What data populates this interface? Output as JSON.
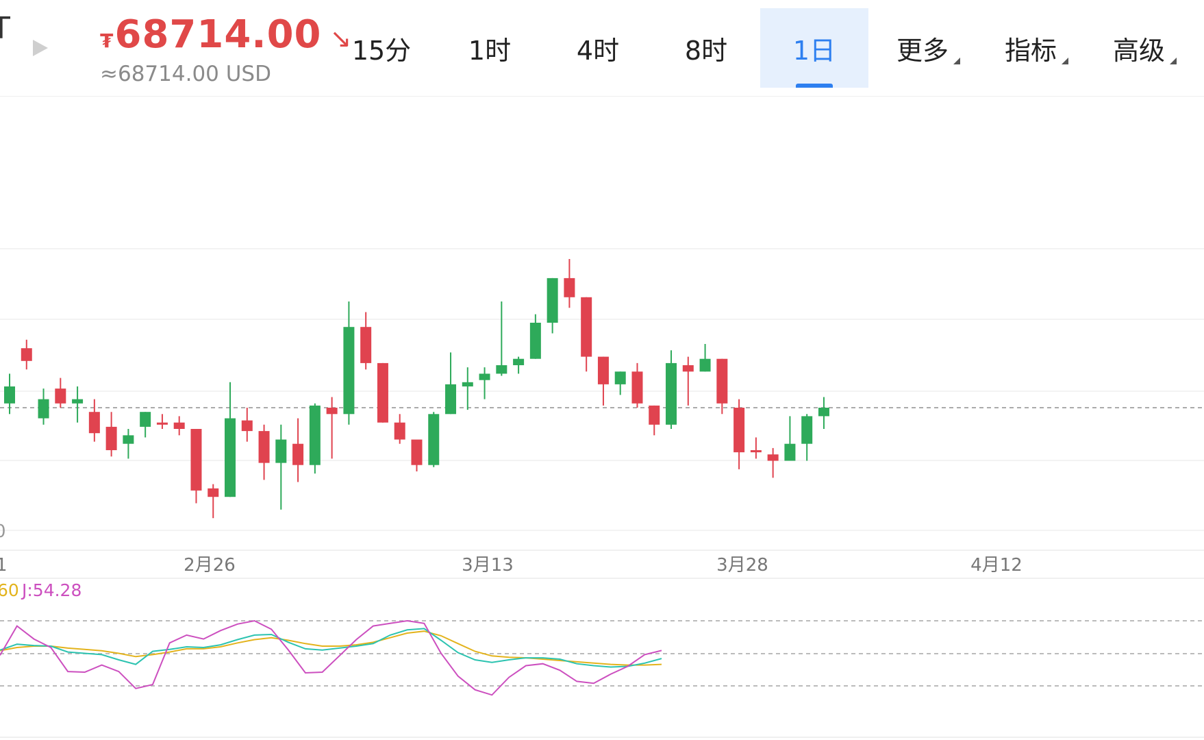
{
  "header": {
    "cut_text": "T",
    "currency_symbol": "₮",
    "price": "68714.00",
    "usd": "≈68714.00 USD",
    "down_color": "#e04848"
  },
  "tabs": [
    {
      "label": "15分",
      "active": false,
      "dropdown": false
    },
    {
      "label": "1时",
      "active": false,
      "dropdown": false
    },
    {
      "label": "4时",
      "active": false,
      "dropdown": false
    },
    {
      "label": "8时",
      "active": false,
      "dropdown": false
    },
    {
      "label": "1日",
      "active": true,
      "dropdown": false
    },
    {
      "label": "更多",
      "active": false,
      "dropdown": true
    },
    {
      "label": "指标",
      "active": false,
      "dropdown": true
    },
    {
      "label": "高级",
      "active": false,
      "dropdown": true
    }
  ],
  "colors": {
    "up": "#2eaa5a",
    "down": "#e0434f",
    "accent": "#2d7ff0",
    "k_line": "#2cc3b0",
    "d_line": "#e3b31c",
    "j_line": "#cc4fbf"
  },
  "chart_data": {
    "type": "candlestick",
    "x_tick_labels": [
      "1",
      "2月26",
      "3月13",
      "3月28",
      "4月12"
    ],
    "y_tick_labels": [
      "0"
    ],
    "kdj_label_partial": "60",
    "kdj_j_label": "J:54.28",
    "candles": [
      {
        "dir": "up",
        "o": 2,
        "c": 10,
        "h": 16,
        "l": -3
      },
      {
        "dir": "down",
        "o": 28,
        "c": 22,
        "h": 32,
        "l": 18
      },
      {
        "dir": "up",
        "o": -5,
        "c": 4,
        "h": 9,
        "l": -8
      },
      {
        "dir": "down",
        "o": 9,
        "c": 2,
        "h": 14,
        "l": 0
      },
      {
        "dir": "up",
        "o": 2,
        "c": 4,
        "h": 10,
        "l": -7
      },
      {
        "dir": "down",
        "o": -2,
        "c": -12,
        "h": 4,
        "l": -16
      },
      {
        "dir": "down",
        "o": -9,
        "c": -20,
        "h": -2,
        "l": -23
      },
      {
        "dir": "up",
        "o": -17,
        "c": -13,
        "h": -10,
        "l": -24
      },
      {
        "dir": "up",
        "o": -9,
        "c": -2,
        "h": -2,
        "l": -14
      },
      {
        "dir": "down",
        "o": -7,
        "c": -8,
        "h": -3,
        "l": -10
      },
      {
        "dir": "down",
        "o": -7,
        "c": -10,
        "h": -4,
        "l": -13
      },
      {
        "dir": "down",
        "o": -10,
        "c": -39,
        "h": -10,
        "l": -45
      },
      {
        "dir": "down",
        "o": -38,
        "c": -42,
        "h": -36,
        "l": -52
      },
      {
        "dir": "up",
        "o": -42,
        "c": -5,
        "h": 12,
        "l": -42
      },
      {
        "dir": "down",
        "o": -6,
        "c": -11,
        "h": 0,
        "l": -16
      },
      {
        "dir": "down",
        "o": -11,
        "c": -26,
        "h": -8,
        "l": -34
      },
      {
        "dir": "up",
        "o": -26,
        "c": -15,
        "h": -8,
        "l": -48
      },
      {
        "dir": "down",
        "o": -17,
        "c": -27,
        "h": -5,
        "l": -35
      },
      {
        "dir": "up",
        "o": -27,
        "c": 1,
        "h": 2,
        "l": -31
      },
      {
        "dir": "down",
        "o": 0,
        "c": -3,
        "h": 5,
        "l": -24
      },
      {
        "dir": "up",
        "o": -3,
        "c": 38,
        "h": 50,
        "l": -8
      },
      {
        "dir": "down",
        "o": 38,
        "c": 21,
        "h": 45,
        "l": 18
      },
      {
        "dir": "down",
        "o": 21,
        "c": -7,
        "h": 21,
        "l": -7
      },
      {
        "dir": "down",
        "o": -7,
        "c": -15,
        "h": -3,
        "l": -17
      },
      {
        "dir": "down",
        "o": -15,
        "c": -27,
        "h": -15,
        "l": -30
      },
      {
        "dir": "up",
        "o": -27,
        "c": -3,
        "h": -2,
        "l": -28
      },
      {
        "dir": "up",
        "o": -3,
        "c": 11,
        "h": 26,
        "l": -3
      },
      {
        "dir": "up",
        "o": 10,
        "c": 12,
        "h": 19,
        "l": -1
      },
      {
        "dir": "up",
        "o": 13,
        "c": 16,
        "h": 19,
        "l": 4
      },
      {
        "dir": "up",
        "o": 16,
        "c": 20,
        "h": 50,
        "l": 15
      },
      {
        "dir": "up",
        "o": 20,
        "c": 23,
        "h": 24,
        "l": 16
      },
      {
        "dir": "up",
        "o": 23,
        "c": 40,
        "h": 44,
        "l": 23
      },
      {
        "dir": "up",
        "o": 40,
        "c": 61,
        "h": 61,
        "l": 35
      },
      {
        "dir": "down",
        "o": 61,
        "c": 52,
        "h": 70,
        "l": 47
      },
      {
        "dir": "down",
        "o": 52,
        "c": 24,
        "h": 52,
        "l": 17
      },
      {
        "dir": "down",
        "o": 24,
        "c": 11,
        "h": 24,
        "l": 1
      },
      {
        "dir": "up",
        "o": 11,
        "c": 17,
        "h": 17,
        "l": 6
      },
      {
        "dir": "down",
        "o": 17,
        "c": 2,
        "h": 21,
        "l": 0
      },
      {
        "dir": "down",
        "o": 1,
        "c": -8,
        "h": 1,
        "l": -13
      },
      {
        "dir": "up",
        "o": -8,
        "c": 21,
        "h": 27,
        "l": -10
      },
      {
        "dir": "down",
        "o": 20,
        "c": 17,
        "h": 24,
        "l": 1
      },
      {
        "dir": "up",
        "o": 17,
        "c": 23,
        "h": 30,
        "l": 17
      },
      {
        "dir": "down",
        "o": 23,
        "c": 2,
        "h": 23,
        "l": -3
      },
      {
        "dir": "down",
        "o": 0,
        "c": -21,
        "h": 4,
        "l": -29
      },
      {
        "dir": "down",
        "o": -20,
        "c": -21,
        "h": -14,
        "l": -24
      },
      {
        "dir": "down",
        "o": -22,
        "c": -25,
        "h": -19,
        "l": -33
      },
      {
        "dir": "up",
        "o": -25,
        "c": -17,
        "h": -4,
        "l": -25
      },
      {
        "dir": "up",
        "o": -17,
        "c": -4,
        "h": -3,
        "l": -25
      },
      {
        "dir": "up",
        "o": -4,
        "c": 0,
        "h": 5,
        "l": -10
      }
    ],
    "k_series": [
      55,
      64,
      62,
      61,
      52,
      50,
      48,
      40,
      33,
      53,
      56,
      60,
      59,
      63,
      71,
      78,
      79,
      67,
      57,
      55,
      58,
      61,
      65,
      78,
      86,
      88,
      70,
      51,
      40,
      36,
      40,
      43,
      43,
      41,
      34,
      31,
      29,
      30,
      35,
      42
    ],
    "d_series": [
      54,
      59,
      61,
      61,
      58,
      56,
      54,
      50,
      45,
      48,
      52,
      57,
      57,
      60,
      66,
      71,
      74,
      70,
      65,
      61,
      61,
      63,
      67,
      74,
      81,
      84,
      77,
      65,
      53,
      46,
      44,
      43,
      41,
      39,
      37,
      35,
      33,
      32,
      32,
      33
    ],
    "j_series": [
      47,
      92,
      72,
      59,
      22,
      21,
      32,
      22,
      -4,
      2,
      66,
      78,
      72,
      85,
      95,
      100,
      87,
      55,
      20,
      21,
      46,
      71,
      92,
      96,
      100,
      96,
      50,
      15,
      -6,
      -14,
      13,
      31,
      34,
      24,
      7,
      4,
      18,
      30,
      48,
      54.28
    ]
  }
}
